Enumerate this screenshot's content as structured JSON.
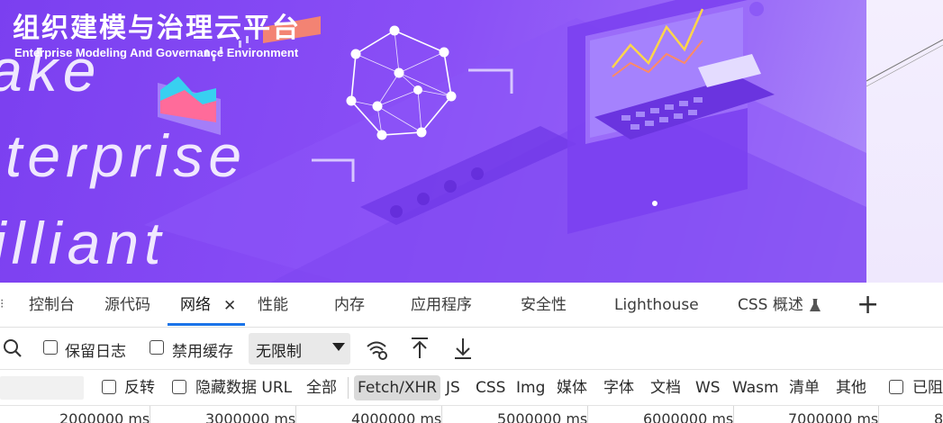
{
  "banner": {
    "title": "组织建模与治理云平台",
    "subtitle": "Enterprise Modeling And Governance Environment",
    "slogan_lines": [
      "ake",
      "terprise",
      "illiant"
    ]
  },
  "tabs": [
    {
      "label": "控制台"
    },
    {
      "label": "源代码"
    },
    {
      "label": "网络",
      "active": true
    },
    {
      "label": "性能"
    },
    {
      "label": "内存"
    },
    {
      "label": "应用程序"
    },
    {
      "label": "安全性"
    },
    {
      "label": "Lighthouse"
    },
    {
      "label": "CSS 概述"
    }
  ],
  "toolbar": {
    "preserve_log": "保留日志",
    "disable_cache": "禁用缓存",
    "throttling": "无限制"
  },
  "filters": {
    "invert": "反转",
    "hide_data_urls": "隐藏数据 URL",
    "types": [
      "全部",
      "Fetch/XHR",
      "JS",
      "CSS",
      "Img",
      "媒体",
      "字体",
      "文档",
      "WS",
      "Wasm",
      "清单",
      "其他"
    ],
    "active_type": "Fetch/XHR",
    "blocked": "已阻"
  },
  "timeline": {
    "ticks": [
      "2000000 ms",
      "3000000 ms",
      "4000000 ms",
      "5000000 ms",
      "6000000 ms",
      "7000000 ms",
      "8"
    ]
  },
  "icons": {
    "search": "search-icon",
    "wifi_settings": "wifi-gear-icon",
    "upload": "upload-icon",
    "download": "download-icon",
    "close": "close-icon",
    "add": "plus-icon",
    "experiment": "flask-icon",
    "dropdown": "caret-down-icon"
  },
  "colors": {
    "banner_purple": "#8a4ff6",
    "active_tab_underline": "#1a73e8",
    "active_chip": "#dadada"
  }
}
